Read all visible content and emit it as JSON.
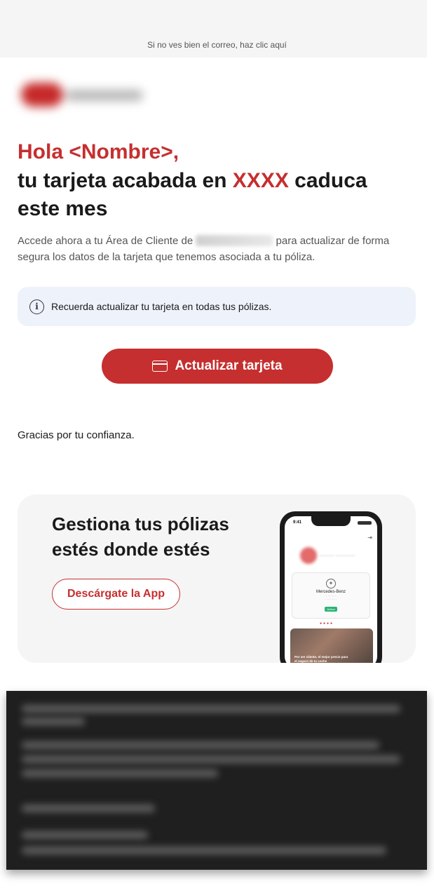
{
  "header": {
    "view_online": "Si no ves bien el correo, haz clic aquí"
  },
  "brand": {
    "logo_icon": "brand-logo-blurred",
    "primary_color": "#c62f2f"
  },
  "hero": {
    "greeting": "Hola <Nombre>,",
    "headline_part1": "tu tarjeta acabada en ",
    "card_digits": "XXXX",
    "headline_part2": " caduca este mes"
  },
  "intro": {
    "text_before": "Accede ahora a tu Área de Cliente de ",
    "text_after": " para actualizar de forma segura los datos de la tarjeta que tenemos asociada a tu póliza."
  },
  "notice": {
    "icon": "info-icon",
    "text": "Recuerda actualizar tu tarjeta en todas tus pólizas."
  },
  "cta": {
    "icon": "credit-card-icon",
    "label": "Actualizar tarjeta"
  },
  "closing": {
    "thanks": "Gracias por tu confianza."
  },
  "app_promo": {
    "title": "Gestiona tus pólizas estés donde estés",
    "button_label": "Descárgate la App",
    "phone": {
      "time": "9:41",
      "car_brand": "Mercedes-Benz",
      "status_badge": "Activa",
      "promo_text": "Por ser cliente, el mejor precio para el seguro de tu coche"
    }
  }
}
